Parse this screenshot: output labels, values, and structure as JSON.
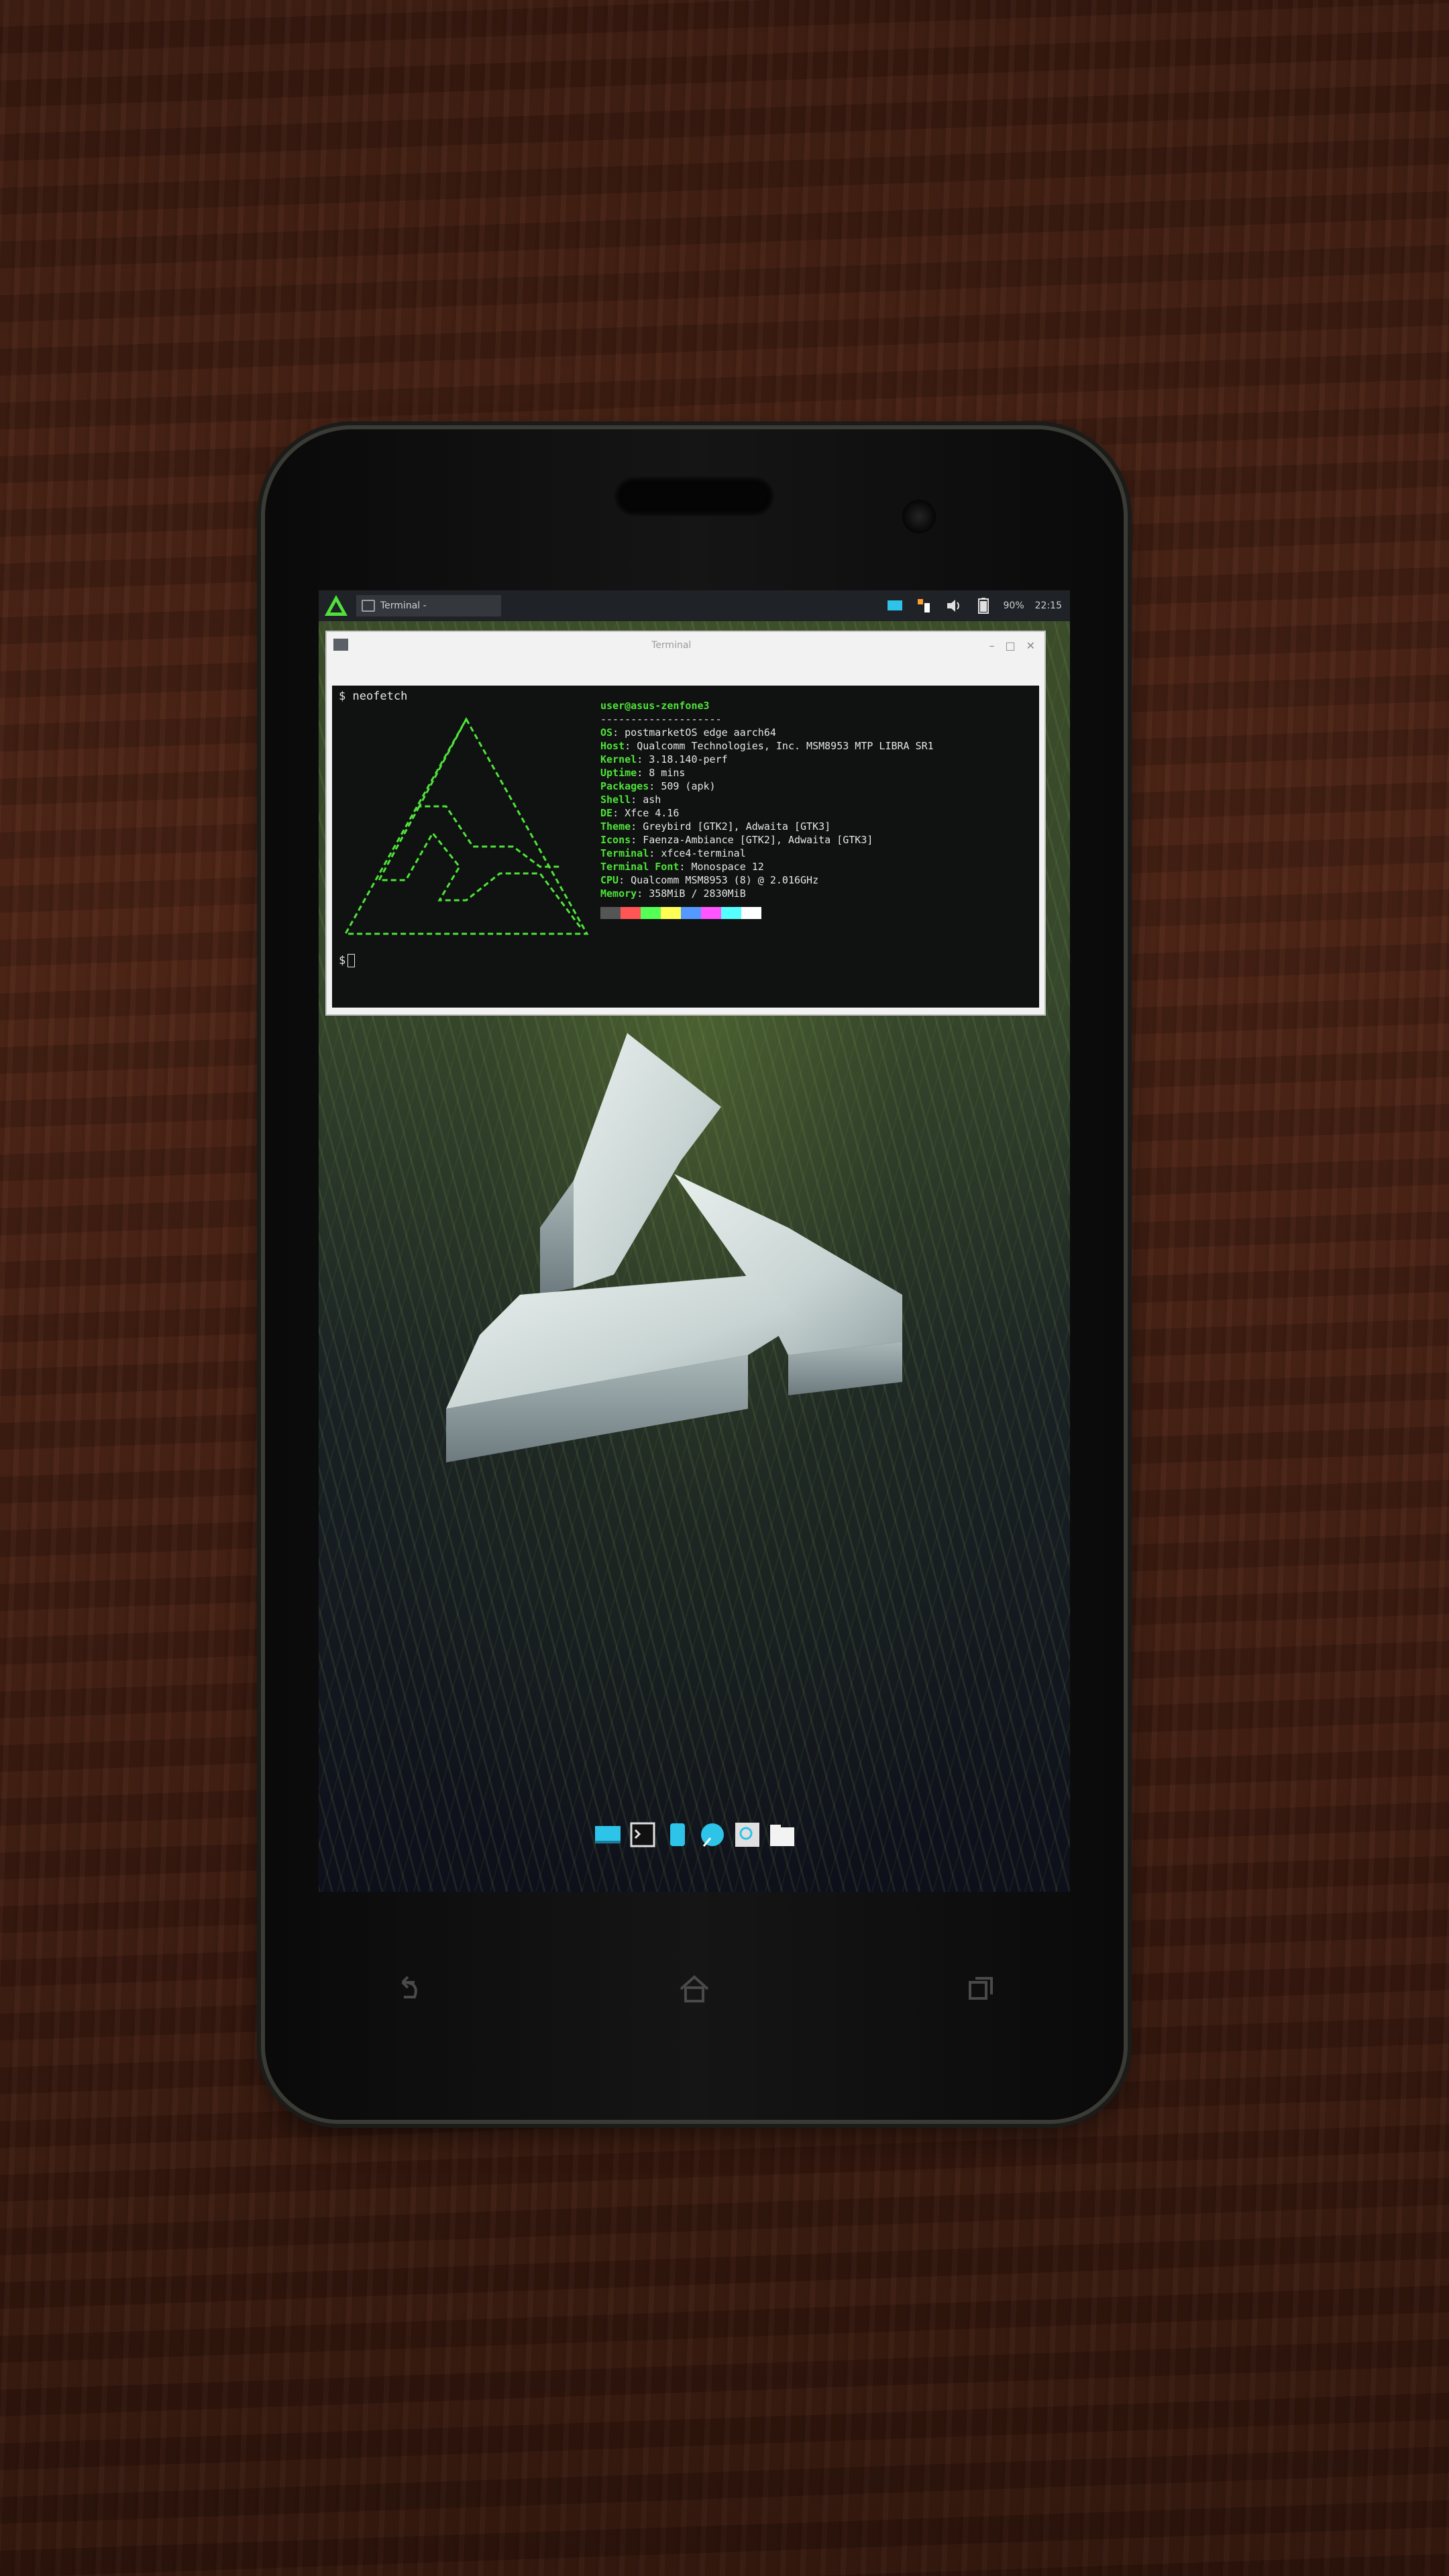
{
  "panel": {
    "task_label": "Terminal -",
    "battery": "90%",
    "time": "22:15"
  },
  "terminal": {
    "window_title": "Terminal",
    "command": "$ neofetch",
    "next_prompt": "$",
    "userhost": "user@asus-zenfone3",
    "rule": "--------------------",
    "info": [
      {
        "key": "OS",
        "value": "postmarketOS edge aarch64"
      },
      {
        "key": "Host",
        "value": "Qualcomm Technologies, Inc. MSM8953 MTP LIBRA SR1"
      },
      {
        "key": "Kernel",
        "value": "3.18.140-perf"
      },
      {
        "key": "Uptime",
        "value": "8 mins"
      },
      {
        "key": "Packages",
        "value": "509 (apk)"
      },
      {
        "key": "Shell",
        "value": "ash"
      },
      {
        "key": "DE",
        "value": "Xfce 4.16"
      },
      {
        "key": "Theme",
        "value": "Greybird [GTK2], Adwaita [GTK3]"
      },
      {
        "key": "Icons",
        "value": "Faenza-Ambiance [GTK2], Adwaita [GTK3]"
      },
      {
        "key": "Terminal",
        "value": "xfce4-terminal"
      },
      {
        "key": "Terminal Font",
        "value": "Monospace 12"
      },
      {
        "key": "CPU",
        "value": "Qualcomm MSM8953 (8) @ 2.016GHz"
      },
      {
        "key": "Memory",
        "value": "358MiB / 2830MiB"
      }
    ]
  },
  "colors": {
    "accent_green": "#4fe33a",
    "panel_bg": "#1f2226",
    "terminal_bg": "#0f1210",
    "dock_cyan": "#2ec3e8"
  },
  "icons": {
    "launcher": "postmarketos-logo-icon",
    "dock": [
      "desktop-icon",
      "terminal-icon",
      "files-icon",
      "browser-icon",
      "search-icon",
      "folder-icon"
    ],
    "nav": [
      "back-icon",
      "home-icon",
      "recents-icon"
    ]
  }
}
